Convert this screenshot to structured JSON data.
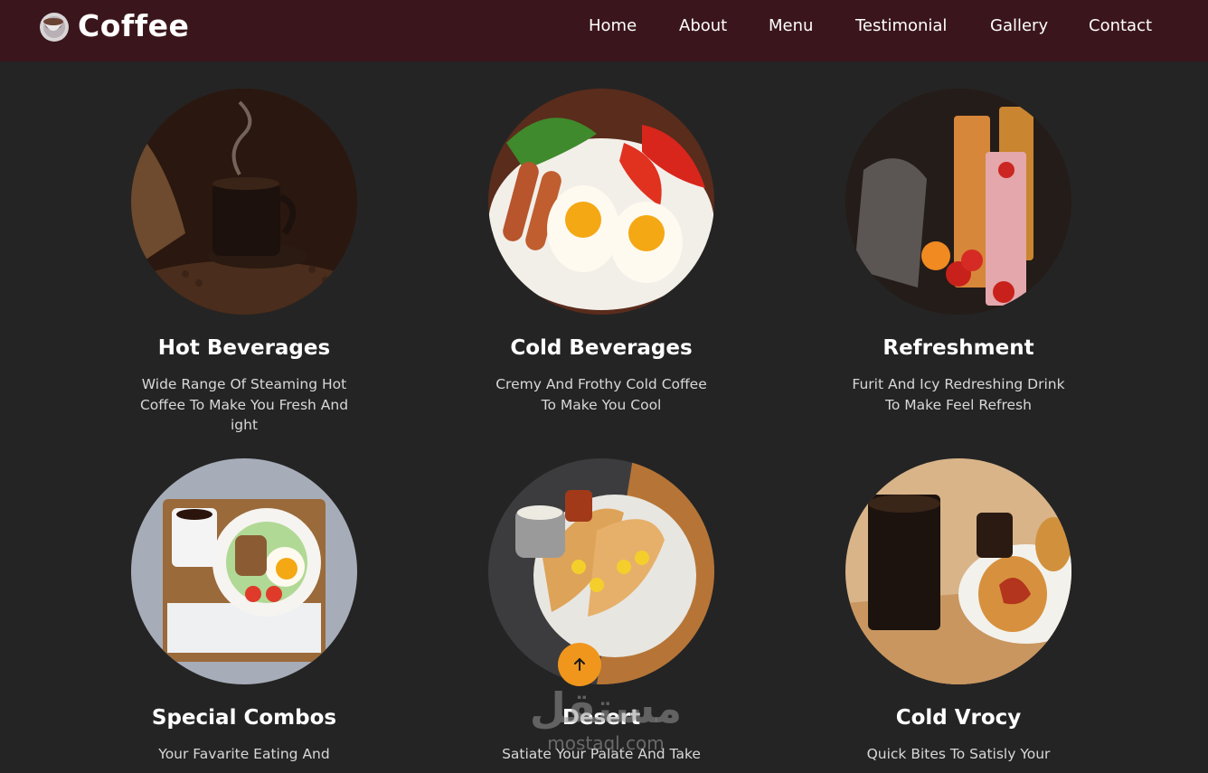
{
  "header": {
    "logo_text": "Coffee",
    "logo_icon": "coffee-cup-icon",
    "nav": [
      "Home",
      "About",
      "Menu",
      "Testimonial",
      "Gallery",
      "Contact"
    ]
  },
  "cards": [
    {
      "title": "Hot Beverages",
      "description": "Wide Range Of Steaming Hot Coffee To Make You Fresh And ight",
      "image": "coffee cup with beans"
    },
    {
      "title": "Cold Beverages",
      "description": "Cremy And Frothy Cold Coffee To Make You Cool",
      "image": "eggs and sausages plate"
    },
    {
      "title": "Refreshment",
      "description": "Furit And Icy Redreshing Drink To Make Feel Refresh",
      "image": "smoothie glasses with fruit"
    },
    {
      "title": "Special Combos",
      "description": "Your Favarite Eating And",
      "image": "breakfast tray"
    },
    {
      "title": "Desert",
      "description": "Satiate Your Palate And Take",
      "image": "stuffed crepes plate"
    },
    {
      "title": "Cold Vrocy",
      "description": "Quick Bites To Satisly Your",
      "image": "coffee and croissant"
    }
  ],
  "scroll_top_icon": "arrow-up-icon",
  "watermark": {
    "arabic": "مستقل",
    "latin": "mostaql.com"
  },
  "colors": {
    "navbar": "#3a161c",
    "background": "#242424",
    "accent": "#f0961d"
  }
}
